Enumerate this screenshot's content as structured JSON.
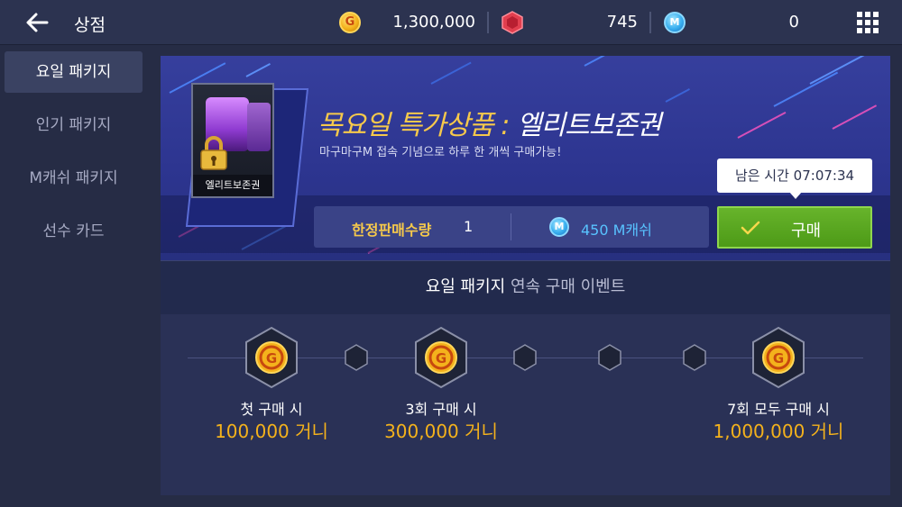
{
  "header": {
    "back_icon": "back-arrow-icon",
    "title": "상점",
    "gold": "1,300,000",
    "gems": "745",
    "mcash": "0",
    "menu_icon": "grid-menu-icon"
  },
  "sidebar": {
    "items": [
      {
        "label": "요일 패키지",
        "active": true
      },
      {
        "label": "인기 패키지",
        "active": false
      },
      {
        "label": "M캐쉬 패키지",
        "active": false
      },
      {
        "label": "선수 카드",
        "active": false
      }
    ]
  },
  "product": {
    "card_label": "엘리트보존권",
    "title_day": "목요일 특가상품 : ",
    "title_item": "엘리트보존권",
    "subtitle": "마구마구M 접속 기념으로 하루 한 개씩 구매가능!",
    "limit_label": "한정판매수량",
    "limit_value": "1",
    "price": "450 M캐쉬",
    "time_left": "남은 시간 07:07:34",
    "buy_label": "구매"
  },
  "event": {
    "title_main": "요일 패키지",
    "title_rest": " 연속 구매 이벤트",
    "rewards": [
      {
        "condition": "첫 구매 시",
        "amount": "100,000 거니"
      },
      {
        "condition": "3회 구매 시",
        "amount": "300,000 거니"
      },
      {
        "condition": "7회 모두 구매 시",
        "amount": "1,000,000 거니"
      }
    ]
  },
  "colors": {
    "accent_gold": "#f4b21c",
    "buy_green": "#5aa71f",
    "mcash_blue": "#58c3ff"
  }
}
